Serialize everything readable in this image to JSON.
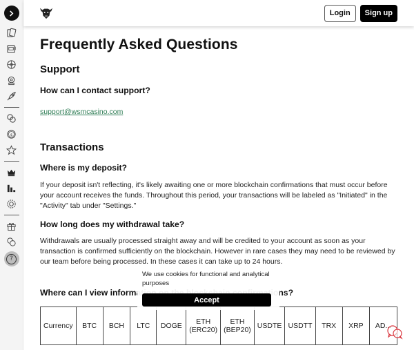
{
  "sidebar": {
    "toggle_icon": "chevron-right-icon",
    "items_group1": [
      {
        "name": "cards",
        "icon": "playing-cards-icon"
      },
      {
        "name": "slots",
        "icon": "slot-machine-icon"
      },
      {
        "name": "roulette",
        "icon": "roulette-icon"
      },
      {
        "name": "lottery",
        "icon": "lottery-ball-icon"
      },
      {
        "name": "crash",
        "icon": "rocket-icon"
      }
    ],
    "items_group2": [
      {
        "name": "sports",
        "icon": "sports-balls-icon"
      },
      {
        "name": "coin",
        "icon": "dollar-coin-icon"
      },
      {
        "name": "favorites",
        "icon": "star-icon"
      }
    ],
    "items_group3": [
      {
        "name": "vip",
        "icon": "crown-icon"
      },
      {
        "name": "leaderboard",
        "icon": "bar-chart-icon"
      },
      {
        "name": "chip",
        "icon": "casino-chip-icon"
      }
    ],
    "items_group4": [
      {
        "name": "promotions",
        "icon": "gift-icon"
      },
      {
        "name": "currency",
        "icon": "currency-exchange-icon"
      },
      {
        "name": "help",
        "icon": "question-mark-icon",
        "label": "?"
      }
    ]
  },
  "header": {
    "logo": "bull-logo",
    "login_label": "Login",
    "signup_label": "Sign up"
  },
  "page": {
    "title": "Frequently Asked Questions",
    "sections": [
      {
        "heading": "Support",
        "questions": [
          {
            "q": "How can I contact support?",
            "link": "support@wsmcasino.com"
          }
        ]
      },
      {
        "heading": "Transactions",
        "questions": [
          {
            "q": "Where is my deposit?",
            "a": "If your deposit isn't reflecting, it's likely awaiting one or more blockchain confirmations that must occur before your account receives the funds. Throughout this period, your transactions will be labeled as \"Initiated\" in the \"Activity\" tab under \"Settings.\""
          },
          {
            "q": "How long does my withdrawal take?",
            "a": "Withdrawals are usually processed straight away and will be credited to your account as soon as your transaction is confirmed sufficiently on the blockchain. However in rare cases they may need to be reviewed by our team before being processed. In these cases it can take up to 24 hours."
          },
          {
            "q": "Where can I view information on the blockchain confirmations?"
          }
        ]
      }
    ],
    "table": {
      "cells": [
        "Currency",
        "BTC",
        "BCH",
        "LTC",
        "DOGE",
        "ETH (ERC20)",
        "ETH (BEP20)",
        "USDTE",
        "USDTT",
        "TRX",
        "XRP",
        "AD..."
      ]
    }
  },
  "cookie_banner": {
    "text": "We use cookies for functional and analytical purposes",
    "accept_label": "Accept"
  },
  "chat_widget": {
    "icon": "chat-bubbles-icon",
    "color": "#d9363e"
  }
}
